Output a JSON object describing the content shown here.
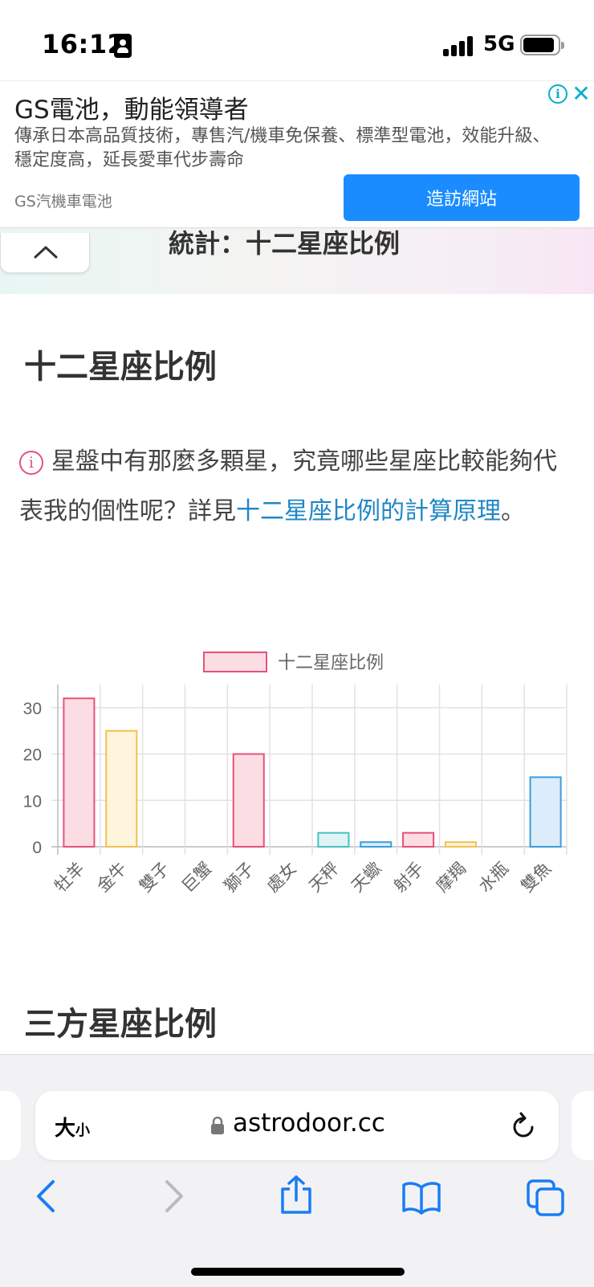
{
  "status_bar": {
    "time": "16:12",
    "network": "5G"
  },
  "ad": {
    "title": "GS電池，動能領導者",
    "description": "傳承日本高品質技術，專售汽/機車免保養、標準型電池，效能升級、穩定度高，延長愛車代步壽命",
    "source": "GS汽機車電池",
    "cta": "造訪網站",
    "info_glyph": "i",
    "close_glyph": "✕"
  },
  "page": {
    "header_title": "統計：十二星座比例",
    "section_title": "十二星座比例",
    "intro_text": "星盤中有那麼多顆星，究竟哪些星座比較能夠代表我的個性呢？詳見",
    "intro_link": "十二星座比例的計算原理",
    "intro_end": "。",
    "info_glyph": "i",
    "next_section_title": "三方星座比例"
  },
  "chart_data": {
    "type": "bar",
    "categories": [
      "牡羊",
      "金牛",
      "雙子",
      "巨蟹",
      "獅子",
      "處女",
      "天秤",
      "天蠍",
      "射手",
      "摩羯",
      "水瓶",
      "雙魚"
    ],
    "series": [
      {
        "name": "十二星座比例",
        "values": [
          32,
          25,
          0,
          0,
          20,
          0,
          3,
          1,
          3,
          1,
          0,
          15
        ]
      }
    ],
    "bar_fills": [
      "#fddde4",
      "#fff4dc",
      "#dff4f4",
      "#dcecfa",
      "#fddde4",
      "#ece3fb",
      "#dff4f4",
      "#dcecfa",
      "#fddde4",
      "#fff4dc",
      "#dff4f4",
      "#dcecfa"
    ],
    "bar_strokes": [
      "#e5527a",
      "#f2c14e",
      "#4bc0c0",
      "#3a9ddc",
      "#e5527a",
      "#9966ff",
      "#4bc0c0",
      "#3a9ddc",
      "#e5527a",
      "#f2c14e",
      "#4bc0c0",
      "#3a9ddc"
    ],
    "yticks": [
      0,
      10,
      20,
      30
    ],
    "ylim": [
      0,
      35
    ],
    "legend_position": "top",
    "grid": true
  },
  "browser": {
    "text_size_label": "大",
    "text_size_small": "小",
    "url": "astrodoor.cc"
  }
}
